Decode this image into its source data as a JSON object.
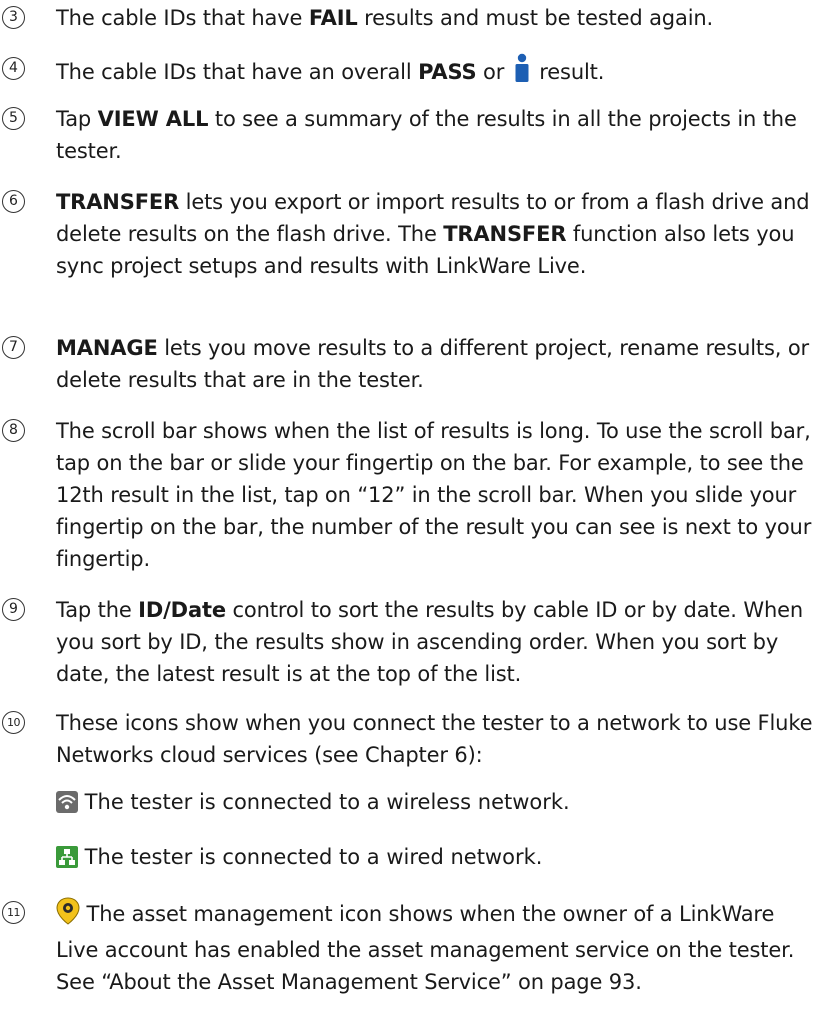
{
  "items": {
    "i3": {
      "num": "3",
      "pre": "The cable IDs that have ",
      "b1": "FAIL",
      "post": " results and must be tested again."
    },
    "i4": {
      "num": "4",
      "pre": "The cable IDs that have an overall ",
      "b1": "PASS",
      "mid": " or ",
      "post": " result."
    },
    "i5": {
      "num": "5",
      "pre": "Tap ",
      "b1": "VIEW ALL",
      "post": " to see a summary of the results in all the projects in the tester."
    },
    "i6": {
      "num": "6",
      "b1": "TRANSFER",
      "mid": " lets you export or import results to or from a flash drive and delete results on the flash drive. The ",
      "b2": "TRANSFER",
      "post": " function also lets you sync project setups and results with LinkWare Live."
    },
    "i7": {
      "num": "7",
      "b1": "MANAGE",
      "post": " lets you move results to a different project, rename results, or delete results that are in the tester."
    },
    "i8": {
      "num": "8",
      "text": "The scroll bar shows when the list of results is long. To use the scroll bar, tap on the bar or slide your fingertip on the bar. For example, to see the 12th result in the list, tap on “12” in the scroll bar. When you slide your fingertip on the bar, the number of the result you can see is next to your fingertip."
    },
    "i9": {
      "num": "9",
      "pre": "Tap the ",
      "b1": "ID",
      "mid": "/",
      "b2": "Date",
      "post": " control to sort the results by cable ID or by date. When you sort by ID, the results show in ascending order. When you sort by date, the latest result is at the top of the list."
    },
    "i10": {
      "num": "10",
      "text": "These icons show when you connect the tester to a network to use Fluke Networks cloud services (see Chapter 6):",
      "wireless": " The tester is connected to a wireless network.",
      "wired": " The tester is connected to a wired network."
    },
    "i11": {
      "num": "11",
      "text": " The asset management icon shows when the owner of a LinkWare Live account has enabled the asset management service on the tester. See “About the Asset Management Service” on page 93."
    }
  },
  "icons": {
    "info": "info-person-icon",
    "wireless": "wireless-icon",
    "wired": "wired-network-icon",
    "asset": "asset-management-icon"
  },
  "colors": {
    "info_blue": "#1d5fb3",
    "wifi_gray": "#6b6b6b",
    "wired_green": "#3a9a3a",
    "asset_yellow": "#f2c21b"
  }
}
